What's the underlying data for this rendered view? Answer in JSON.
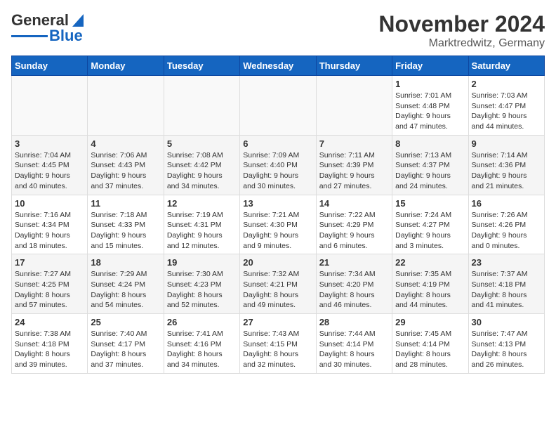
{
  "header": {
    "logo_line1": "General",
    "logo_line2": "Blue",
    "month": "November 2024",
    "location": "Marktredwitz, Germany"
  },
  "weekdays": [
    "Sunday",
    "Monday",
    "Tuesday",
    "Wednesday",
    "Thursday",
    "Friday",
    "Saturday"
  ],
  "weeks": [
    [
      {
        "day": "",
        "info": ""
      },
      {
        "day": "",
        "info": ""
      },
      {
        "day": "",
        "info": ""
      },
      {
        "day": "",
        "info": ""
      },
      {
        "day": "",
        "info": ""
      },
      {
        "day": "1",
        "info": "Sunrise: 7:01 AM\nSunset: 4:48 PM\nDaylight: 9 hours\nand 47 minutes."
      },
      {
        "day": "2",
        "info": "Sunrise: 7:03 AM\nSunset: 4:47 PM\nDaylight: 9 hours\nand 44 minutes."
      }
    ],
    [
      {
        "day": "3",
        "info": "Sunrise: 7:04 AM\nSunset: 4:45 PM\nDaylight: 9 hours\nand 40 minutes."
      },
      {
        "day": "4",
        "info": "Sunrise: 7:06 AM\nSunset: 4:43 PM\nDaylight: 9 hours\nand 37 minutes."
      },
      {
        "day": "5",
        "info": "Sunrise: 7:08 AM\nSunset: 4:42 PM\nDaylight: 9 hours\nand 34 minutes."
      },
      {
        "day": "6",
        "info": "Sunrise: 7:09 AM\nSunset: 4:40 PM\nDaylight: 9 hours\nand 30 minutes."
      },
      {
        "day": "7",
        "info": "Sunrise: 7:11 AM\nSunset: 4:39 PM\nDaylight: 9 hours\nand 27 minutes."
      },
      {
        "day": "8",
        "info": "Sunrise: 7:13 AM\nSunset: 4:37 PM\nDaylight: 9 hours\nand 24 minutes."
      },
      {
        "day": "9",
        "info": "Sunrise: 7:14 AM\nSunset: 4:36 PM\nDaylight: 9 hours\nand 21 minutes."
      }
    ],
    [
      {
        "day": "10",
        "info": "Sunrise: 7:16 AM\nSunset: 4:34 PM\nDaylight: 9 hours\nand 18 minutes."
      },
      {
        "day": "11",
        "info": "Sunrise: 7:18 AM\nSunset: 4:33 PM\nDaylight: 9 hours\nand 15 minutes."
      },
      {
        "day": "12",
        "info": "Sunrise: 7:19 AM\nSunset: 4:31 PM\nDaylight: 9 hours\nand 12 minutes."
      },
      {
        "day": "13",
        "info": "Sunrise: 7:21 AM\nSunset: 4:30 PM\nDaylight: 9 hours\nand 9 minutes."
      },
      {
        "day": "14",
        "info": "Sunrise: 7:22 AM\nSunset: 4:29 PM\nDaylight: 9 hours\nand 6 minutes."
      },
      {
        "day": "15",
        "info": "Sunrise: 7:24 AM\nSunset: 4:27 PM\nDaylight: 9 hours\nand 3 minutes."
      },
      {
        "day": "16",
        "info": "Sunrise: 7:26 AM\nSunset: 4:26 PM\nDaylight: 9 hours\nand 0 minutes."
      }
    ],
    [
      {
        "day": "17",
        "info": "Sunrise: 7:27 AM\nSunset: 4:25 PM\nDaylight: 8 hours\nand 57 minutes."
      },
      {
        "day": "18",
        "info": "Sunrise: 7:29 AM\nSunset: 4:24 PM\nDaylight: 8 hours\nand 54 minutes."
      },
      {
        "day": "19",
        "info": "Sunrise: 7:30 AM\nSunset: 4:23 PM\nDaylight: 8 hours\nand 52 minutes."
      },
      {
        "day": "20",
        "info": "Sunrise: 7:32 AM\nSunset: 4:21 PM\nDaylight: 8 hours\nand 49 minutes."
      },
      {
        "day": "21",
        "info": "Sunrise: 7:34 AM\nSunset: 4:20 PM\nDaylight: 8 hours\nand 46 minutes."
      },
      {
        "day": "22",
        "info": "Sunrise: 7:35 AM\nSunset: 4:19 PM\nDaylight: 8 hours\nand 44 minutes."
      },
      {
        "day": "23",
        "info": "Sunrise: 7:37 AM\nSunset: 4:18 PM\nDaylight: 8 hours\nand 41 minutes."
      }
    ],
    [
      {
        "day": "24",
        "info": "Sunrise: 7:38 AM\nSunset: 4:18 PM\nDaylight: 8 hours\nand 39 minutes."
      },
      {
        "day": "25",
        "info": "Sunrise: 7:40 AM\nSunset: 4:17 PM\nDaylight: 8 hours\nand 37 minutes."
      },
      {
        "day": "26",
        "info": "Sunrise: 7:41 AM\nSunset: 4:16 PM\nDaylight: 8 hours\nand 34 minutes."
      },
      {
        "day": "27",
        "info": "Sunrise: 7:43 AM\nSunset: 4:15 PM\nDaylight: 8 hours\nand 32 minutes."
      },
      {
        "day": "28",
        "info": "Sunrise: 7:44 AM\nSunset: 4:14 PM\nDaylight: 8 hours\nand 30 minutes."
      },
      {
        "day": "29",
        "info": "Sunrise: 7:45 AM\nSunset: 4:14 PM\nDaylight: 8 hours\nand 28 minutes."
      },
      {
        "day": "30",
        "info": "Sunrise: 7:47 AM\nSunset: 4:13 PM\nDaylight: 8 hours\nand 26 minutes."
      }
    ]
  ]
}
